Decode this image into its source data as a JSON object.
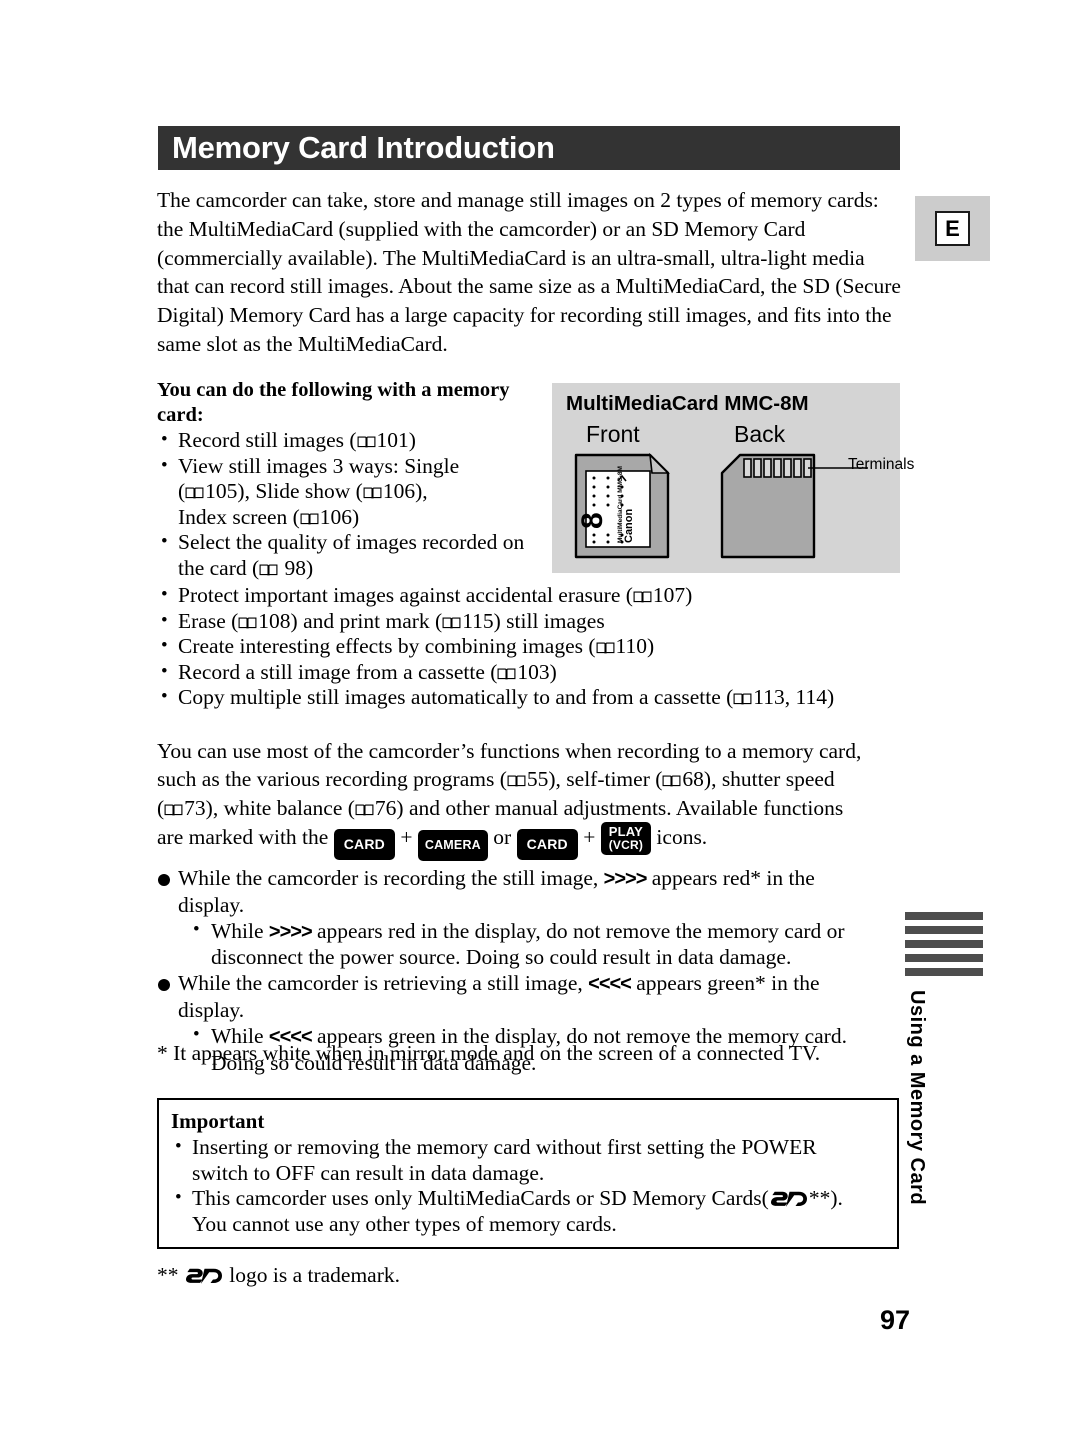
{
  "header": {
    "title": "Memory Card Introduction",
    "lang_marker": "E"
  },
  "intro_paragraph": "The camcorder can take, store and manage still images on 2 types of memory cards: the MultiMediaCard (supplied with the camcorder) or an SD Memory Card (commercially available). The MultiMediaCard is an ultra-small, ultra-light media that can record still images. About the same size as a MultiMediaCard, the SD (Secure Digital) Memory Card has a large capacity for recording still images, and fits into the same slot as the MultiMediaCard.",
  "capabilities": {
    "lead": "You can do the following with a memory card:",
    "items": [
      "Record still images ( 101)",
      "View still images 3 ways: Single ( 105), Slide show ( 106), Index screen ( 106)",
      "Select the quality of images recorded on the card ( 98)",
      "Protect important images against accidental erasure ( 107)",
      "Erase ( 108) and print mark ( 115) still images",
      "Create interesting effects by combining images ( 110)",
      "Record a still image from a cassette ( 103)",
      "Copy multiple still images automatically to and from a cassette ( 113, 114)"
    ],
    "items_plain": {
      "b1_text": "Record still images (",
      "b1_ref": "101",
      "b2_l1": "View still images 3 ways: Single",
      "b2_l2a": "105), Slide show (",
      "b2_l2b": "106),",
      "b2_l3": "Index screen (",
      "b2_l3ref": "106)",
      "b3_l1": "Select the quality of images recorded on",
      "b3_l2": "the card (",
      "b3_l2ref": "98)",
      "b4a": "Protect important images against accidental erasure (",
      "b4ref": "107)",
      "b5a": "Erase (",
      "b5ref1": "108) and print mark (",
      "b5ref2": "115) still images",
      "b6a": "Create interesting effects by combining images (",
      "b6ref": "110)",
      "b7a": "Record a still image from a cassette (",
      "b7ref": "103)",
      "b8a": "Copy multiple still images automatically to and from a cassette (",
      "b8ref": "113, 114)"
    }
  },
  "mmc_diagram": {
    "title": "MultiMediaCard MMC-8M",
    "front_label": "Front",
    "back_label": "Back",
    "terminals_label": "Terminals",
    "card_brand": "Canon",
    "card_model_text": "MultiMediaCard MMC-8M",
    "card_capacity_mark": "8",
    "panel_color": "#d4d4d4",
    "card_body_color": "#a8a8a8"
  },
  "functions_paragraph": {
    "line1": "You can use most of the camcorder’s functions when recording to a memory card,",
    "line2a": "such as the various recording programs (",
    "line2ref1": "55), self-timer (",
    "line2ref2": "68), shutter speed",
    "line3a": "73), white balance (",
    "line3ref": "76) and other manual adjustments. Available functions",
    "line4a": "are marked with the",
    "line4b": "or",
    "line4c": "icons.",
    "badge_card": "CARD",
    "badge_camera": "CAMERA",
    "badge_play_l1": "PLAY",
    "badge_play_l2": "(VCR)",
    "plus": "+"
  },
  "notes": {
    "rec_note_a": "While the camcorder is recording the still image,",
    "rec_arrows": ">>>>",
    "rec_note_b": "appears red* in the",
    "rec_note_c": "display.",
    "rec_sub_a": "While",
    "rec_sub_b": "appears red in the display, do not remove the memory card or",
    "rec_sub_c": "disconnect the power source. Doing so could result in data damage.",
    "ret_note_a": "While the camcorder is retrieving a still image,",
    "ret_arrows": "<<<<",
    "ret_note_b": "appears green* in the",
    "ret_note_c": "display.",
    "ret_sub_a": "While",
    "ret_sub_b": "appears green in the display, do not remove the memory card.",
    "ret_sub_c": "Doing so could result in data damage.",
    "star_note": "* It appears white when in mirror mode and on the screen of a connected TV."
  },
  "important_box": {
    "title": "Important",
    "item1_l1": "Inserting or removing the memory card without first setting the POWER",
    "item1_l2": "switch to OFF can result in data damage.",
    "item2_l1a": "This camcorder uses only MultiMediaCards or SD Memory Cards(",
    "item2_l1b": "**).",
    "item2_l2": "You cannot use any other types of memory cards."
  },
  "trademark_note": {
    "stars": "**",
    "text": "logo is a trademark."
  },
  "side_tab": {
    "label": "Using a Memory Card",
    "bar_count": 5,
    "bar_color": "#4d4d4d"
  },
  "page_number": "97"
}
